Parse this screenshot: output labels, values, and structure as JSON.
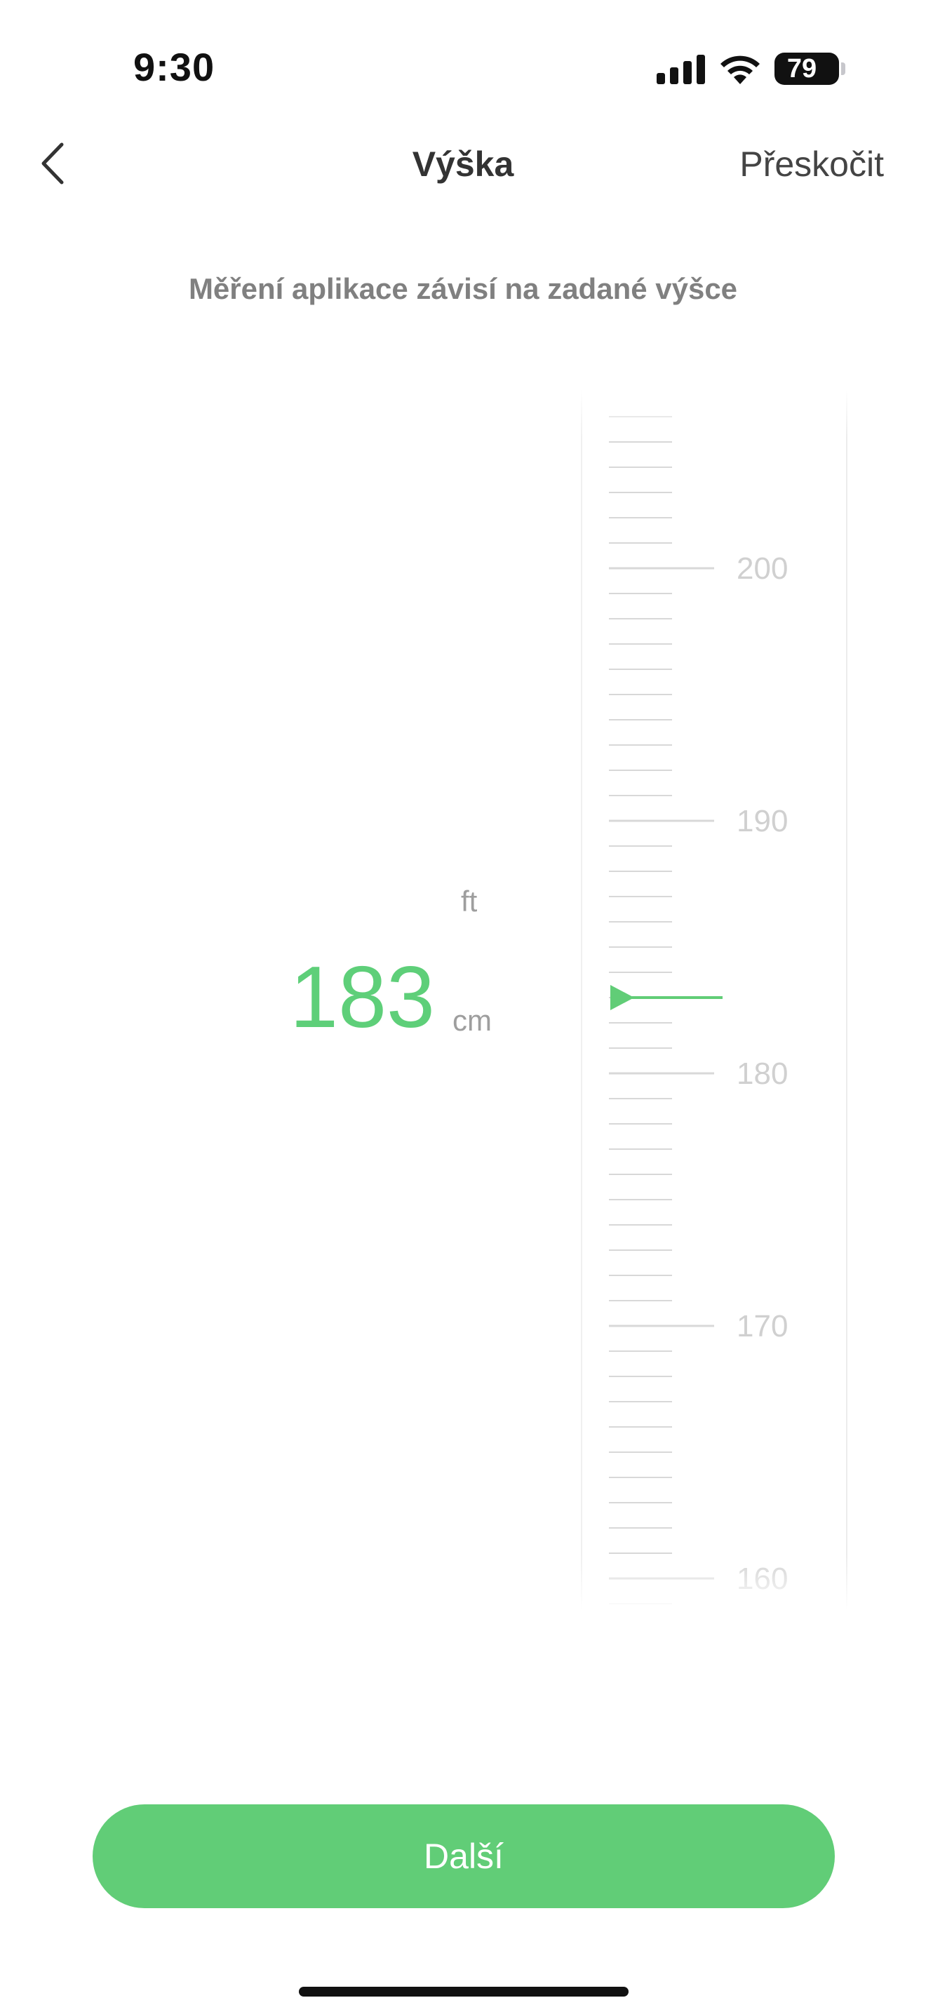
{
  "status_bar": {
    "time": "9:30",
    "battery": "79"
  },
  "nav": {
    "title": "Výška",
    "skip_label": "Přeskočit"
  },
  "subtitle": "Měření aplikace závisí na zadané výšce",
  "height": {
    "value": "183",
    "unit_selected": "cm",
    "unit_alt": "ft",
    "current_cm": 183
  },
  "ruler": {
    "labels": [
      "200",
      "190",
      "180",
      "170",
      "160"
    ],
    "min": 160,
    "max": 200,
    "step": 1
  },
  "next_button": {
    "label": "Další"
  },
  "colors": {
    "accent": "#61cd77",
    "value_text": "#5ecf79",
    "tick": "#d8d8d8",
    "label": "#d0d0d0"
  }
}
